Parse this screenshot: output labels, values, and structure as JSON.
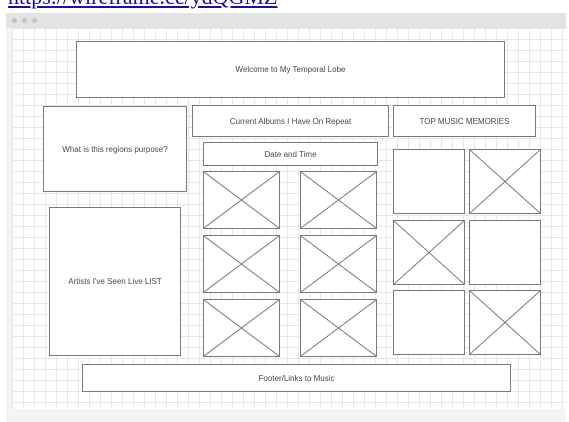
{
  "header_link": "https://wireframe.cc/ydQGMZ",
  "wireframe": {
    "welcome": "Welcome to My Temporal Lobe",
    "region_purpose": "What is this regions purpose?",
    "albums_header": "Current Albums I Have On Repeat",
    "date_time": "Date and Time",
    "top_music": "TOP MUSIC MEMORIES",
    "artists_live": "Artists I've Seen Live LIST",
    "footer": "Footer/Links to Music"
  },
  "colors": {
    "border": "#7a7a7a",
    "grid": "#e7e7e7",
    "text": "#4a4a4a",
    "link": "#1a0dab"
  },
  "icons": {
    "window_controls": "circle-dots",
    "image_placeholder": "crossed-box"
  }
}
